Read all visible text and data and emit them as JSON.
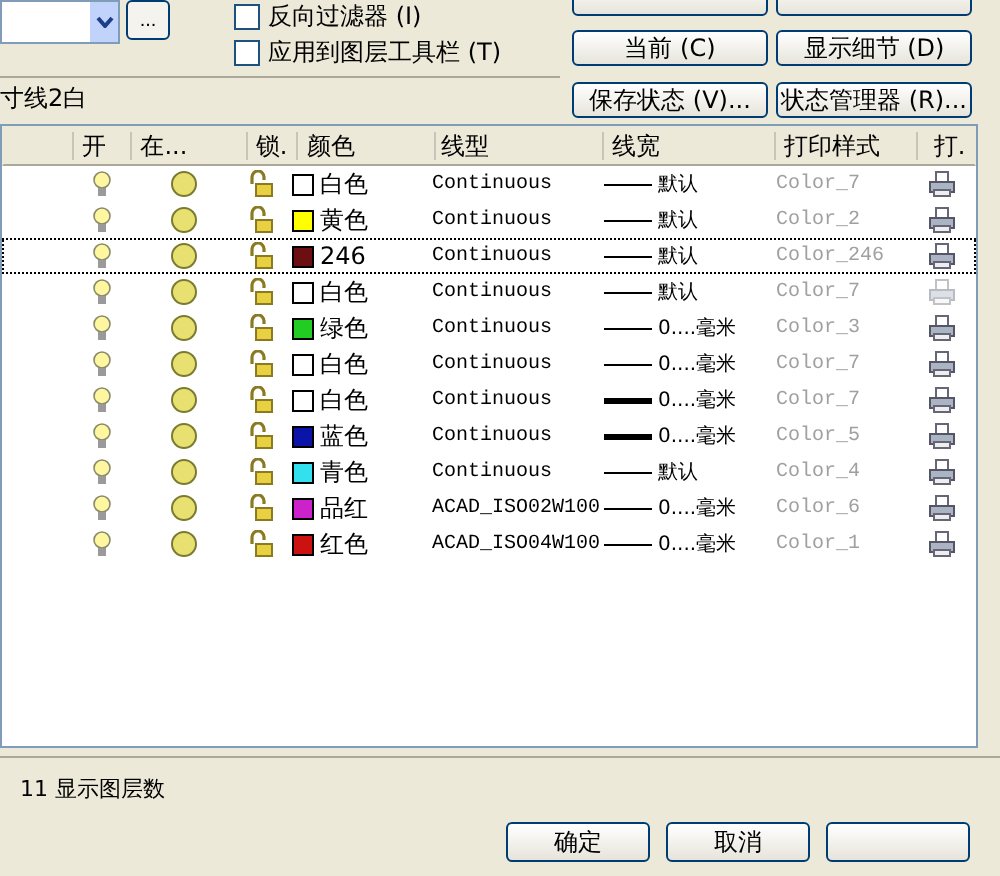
{
  "filters": [
    {
      "label": "反向过滤器 (I)",
      "checked": false
    },
    {
      "label": "应用到图层工具栏 (T)",
      "checked": false
    }
  ],
  "current_layer": "寸线2白",
  "browse_label": "...",
  "buttons": [
    "当前 (C)",
    "显示细节 (D)",
    "保存状态 (V)...",
    "状态管理器 (R)..."
  ],
  "columns": [
    "开",
    "在...",
    "锁.",
    "颜色",
    "线型",
    "线宽",
    "打印样式",
    "打."
  ],
  "layers": [
    {
      "selected": false,
      "on": true,
      "frozen": false,
      "locked": false,
      "color": "#ffffff",
      "color_name": "白色",
      "linetype": "Continuous",
      "heavy": false,
      "lineweight": "默认",
      "plot_style": "Color_7",
      "plot": true
    },
    {
      "selected": false,
      "on": true,
      "frozen": false,
      "locked": false,
      "color": "#ffff00",
      "color_name": "黄色",
      "linetype": "Continuous",
      "heavy": false,
      "lineweight": "默认",
      "plot_style": "Color_2",
      "plot": true
    },
    {
      "selected": true,
      "on": true,
      "frozen": false,
      "locked": false,
      "color": "#6b0f12",
      "color_name": "246",
      "linetype": "Continuous",
      "heavy": false,
      "lineweight": "默认",
      "plot_style": "Color_246",
      "plot": true
    },
    {
      "selected": false,
      "on": true,
      "frozen": false,
      "locked": false,
      "color": "#ffffff",
      "color_name": "白色",
      "linetype": "Continuous",
      "heavy": false,
      "lineweight": "默认",
      "plot_style": "Color_7",
      "plot": false
    },
    {
      "selected": false,
      "on": true,
      "frozen": false,
      "locked": false,
      "color": "#22cc22",
      "color_name": "绿色",
      "linetype": "Continuous",
      "heavy": false,
      "lineweight": "0....毫米",
      "plot_style": "Color_3",
      "plot": true
    },
    {
      "selected": false,
      "on": true,
      "frozen": false,
      "locked": false,
      "color": "#ffffff",
      "color_name": "白色",
      "linetype": "Continuous",
      "heavy": false,
      "lineweight": "0....毫米",
      "plot_style": "Color_7",
      "plot": true
    },
    {
      "selected": false,
      "on": true,
      "frozen": false,
      "locked": false,
      "color": "#ffffff",
      "color_name": "白色",
      "linetype": "Continuous",
      "heavy": true,
      "lineweight": "0....毫米",
      "plot_style": "Color_7",
      "plot": true
    },
    {
      "selected": false,
      "on": true,
      "frozen": false,
      "locked": false,
      "color": "#0a14a8",
      "color_name": "蓝色",
      "linetype": "Continuous",
      "heavy": true,
      "lineweight": "0....毫米",
      "plot_style": "Color_5",
      "plot": true
    },
    {
      "selected": false,
      "on": true,
      "frozen": false,
      "locked": false,
      "color": "#33e0ee",
      "color_name": "青色",
      "linetype": "Continuous",
      "heavy": false,
      "lineweight": "默认",
      "plot_style": "Color_4",
      "plot": true
    },
    {
      "selected": false,
      "on": true,
      "frozen": false,
      "locked": false,
      "color": "#cc22cc",
      "color_name": "品红",
      "linetype": "ACAD_ISO02W100",
      "heavy": false,
      "lineweight": "0....毫米",
      "plot_style": "Color_6",
      "plot": true
    },
    {
      "selected": false,
      "on": true,
      "frozen": false,
      "locked": false,
      "color": "#cc1111",
      "color_name": "红色",
      "linetype": "ACAD_ISO04W100",
      "heavy": false,
      "lineweight": "0....毫米",
      "plot_style": "Color_1",
      "plot": true
    }
  ],
  "layer_count": "11 显示图层数",
  "dialog_buttons": [
    "确定",
    "取消"
  ]
}
